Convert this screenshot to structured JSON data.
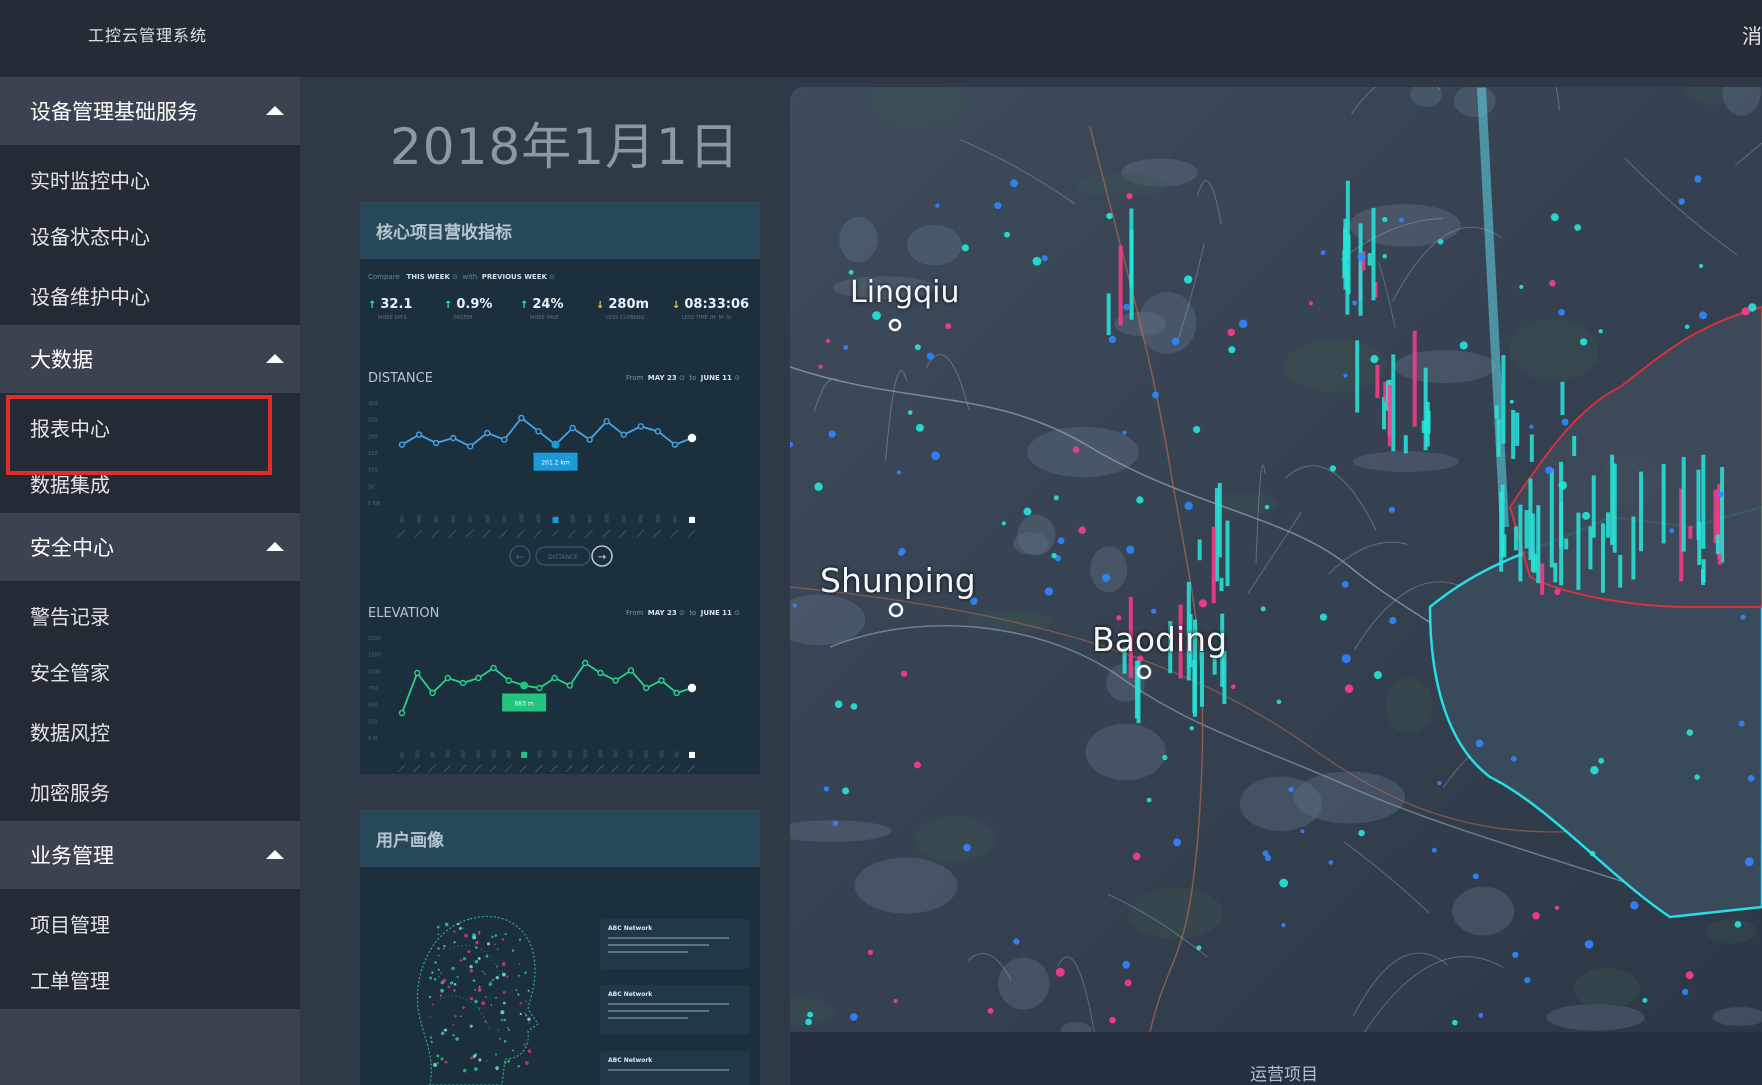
{
  "app": {
    "title": "工控云管理系统",
    "message_link": "消息"
  },
  "sidebar": {
    "groups": [
      {
        "label": "设备管理基础服务",
        "items": [
          "实时监控中心",
          "设备状态中心",
          "设备维护中心"
        ]
      },
      {
        "label": "大数据",
        "items": [
          "报表中心",
          "数据集成"
        ],
        "highlighted": "报表中心"
      },
      {
        "label": "安全中心",
        "items": [
          "警告记录",
          "安全管家",
          "数据风控",
          "加密服务"
        ]
      },
      {
        "label": "业务管理",
        "items": [
          "项目管理",
          "工单管理"
        ]
      }
    ]
  },
  "main": {
    "date": "2018年1月1日",
    "revenue_panel": {
      "title": "核心项目营收指标",
      "compare": {
        "label": "Compare",
        "this": "THIS WEEK",
        "with": "with",
        "prev": "PREVIOUS WEEK"
      },
      "kpis": [
        {
          "value": "32.1",
          "direction": "up",
          "sub": "MORE KM'S"
        },
        {
          "value": "0.9%",
          "direction": "up",
          "sub": "FASTER"
        },
        {
          "value": "24%",
          "direction": "up",
          "sub": "MORE PAVE"
        },
        {
          "value": "280m",
          "direction": "down",
          "sub": "LESS CLIMBING"
        },
        {
          "value": "08:33:06",
          "direction": "down",
          "sub": "LESS TIME (H: M: S)"
        }
      ],
      "distance": {
        "label": "DISTANCE",
        "from_label": "From",
        "from": "MAY 23",
        "to_label": "to",
        "to": "JUNE 11",
        "tooltip": "201.2 km",
        "nav_label": "DISTANCE"
      },
      "elevation": {
        "label": "ELEVATION",
        "from_label": "From",
        "from": "MAY 23",
        "to_label": "to",
        "to": "JUNE 11",
        "tooltip": "683 m"
      }
    },
    "profile_panel": {
      "title": "用户画像",
      "chat_cards": [
        {
          "who": "ABC Network"
        },
        {
          "who": "ABC Network"
        },
        {
          "who": "ABC Network"
        }
      ]
    },
    "map": {
      "cities": [
        "Lingqiu",
        "Shunping",
        "Baoding"
      ],
      "footer_label": "运营项目"
    }
  },
  "chart_data": [
    {
      "type": "line",
      "title": "DISTANCE",
      "y_ticks": [
        "300",
        "250",
        "200",
        "150",
        "100",
        "50",
        "0 KM"
      ],
      "ylim": [
        0,
        300
      ],
      "values": [
        175,
        205,
        180,
        195,
        170,
        210,
        190,
        255,
        215,
        175,
        225,
        190,
        245,
        205,
        230,
        215,
        175,
        195
      ],
      "highlight_index": 9,
      "highlight_label": "201.2 km"
    },
    {
      "type": "line",
      "title": "ELEVATION",
      "y_ticks": [
        "2000",
        "1500",
        "1000",
        "750",
        "500",
        "250",
        "0 M"
      ],
      "ylim": [
        0,
        2000
      ],
      "values": [
        500,
        1300,
        900,
        1200,
        1100,
        1200,
        1400,
        1150,
        1050,
        1000,
        1200,
        1050,
        1500,
        1300,
        1150,
        1350,
        1000,
        1150,
        900,
        1000
      ],
      "highlight_index": 8,
      "highlight_label": "683 m"
    }
  ]
}
